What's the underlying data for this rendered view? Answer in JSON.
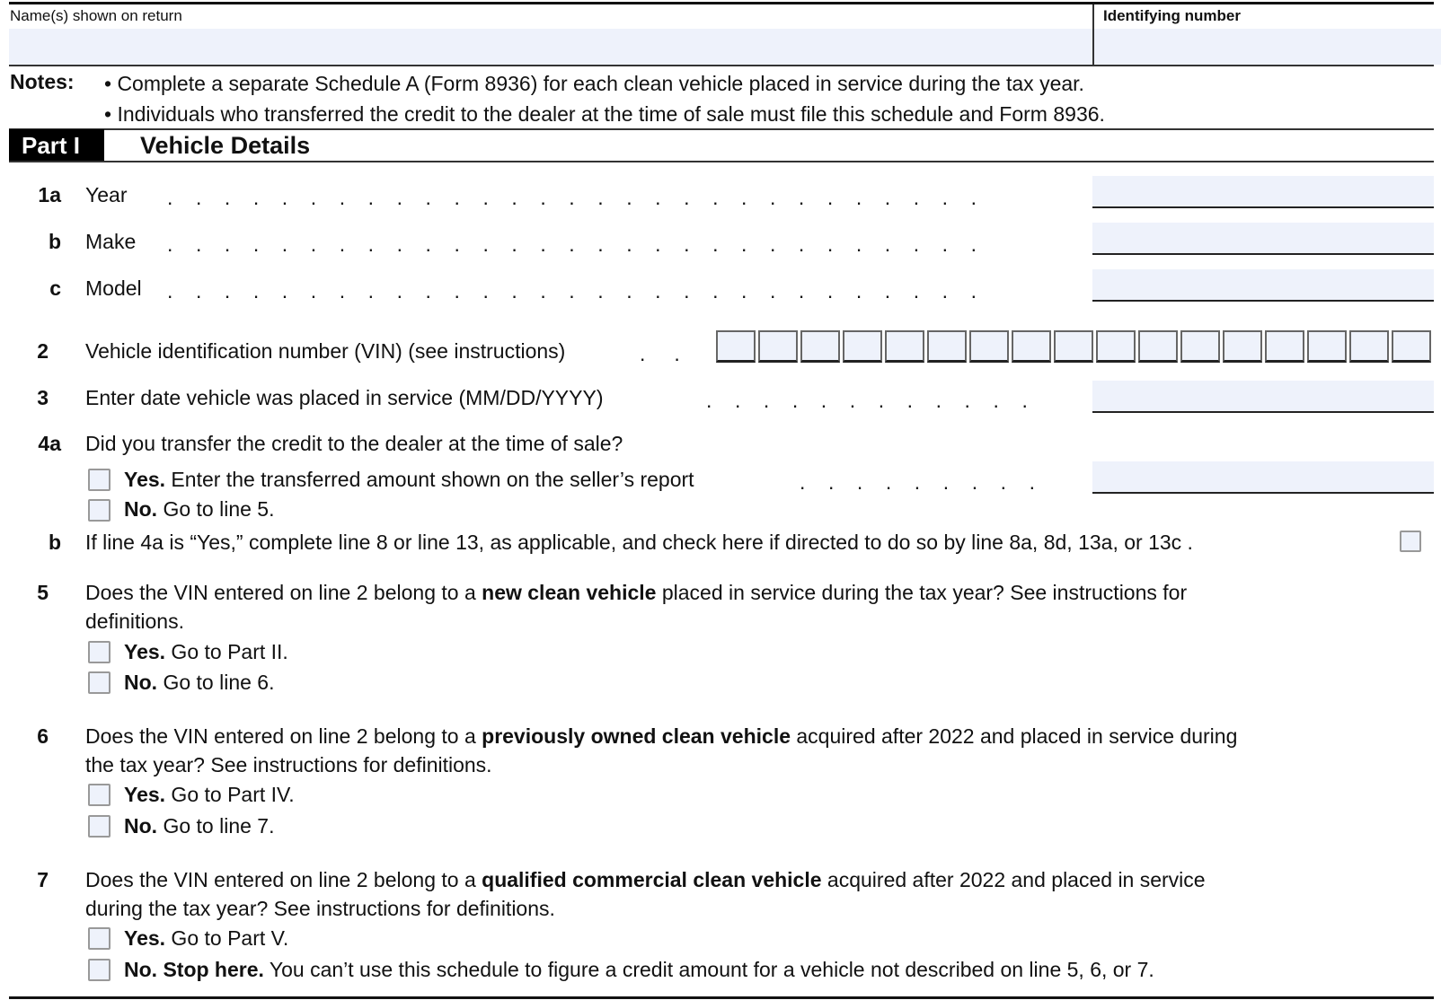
{
  "header": {
    "name_label": "Name(s) shown on return",
    "name_value": "",
    "id_label": "Identifying number",
    "id_value": ""
  },
  "notes": {
    "label": "Notes:",
    "items": [
      "• Complete a separate Schedule A (Form 8936) for each clean vehicle placed in service during the tax year.",
      "• Individuals who transferred the credit to the dealer at the time of sale must file this schedule and Form 8936."
    ]
  },
  "part": {
    "badge": "Part I",
    "title": "Vehicle Details"
  },
  "lines": {
    "l1a": {
      "num": "1a",
      "label": "Year",
      "value": ""
    },
    "l1b": {
      "num": "b",
      "label": "Make",
      "value": ""
    },
    "l1c": {
      "num": "c",
      "label": "Model",
      "value": ""
    },
    "l2": {
      "num": "2",
      "label": "Vehicle identification number (VIN) (see instructions)",
      "vin_boxes": 17,
      "value": ""
    },
    "l3": {
      "num": "3",
      "label": "Enter date vehicle was placed in service (MM/DD/YYYY)",
      "value": ""
    },
    "l4a": {
      "num": "4a",
      "question": "Did you transfer the credit to the dealer at the time of sale?",
      "yes_bold": "Yes.",
      "yes_text": " Enter the transferred amount shown on the seller’s report",
      "no_bold": "No.",
      "no_text": " Go to line 5.",
      "yes_checked": false,
      "no_checked": false,
      "amount": ""
    },
    "l4b": {
      "num": "b",
      "text": "If line 4a is “Yes,” complete line 8 or line 13, as applicable, and check here if directed to do so by line 8a, 8d, 13a, or 13c",
      "checked": false
    },
    "l5": {
      "num": "5",
      "pre": "Does the VIN entered on line 2 belong to a ",
      "bold": "new clean vehicle",
      "post": " placed in service during the tax year? See instructions for",
      "line2": "definitions.",
      "yes_bold": "Yes.",
      "yes_text": " Go to Part II.",
      "no_bold": "No.",
      "no_text": " Go to line 6."
    },
    "l6": {
      "num": "6",
      "pre": "Does the VIN entered on line 2 belong to a ",
      "bold": "previously owned clean vehicle",
      "post": " acquired after 2022 and placed in service during",
      "line2": "the tax year? See instructions for definitions.",
      "yes_bold": "Yes.",
      "yes_text": " Go to Part IV.",
      "no_bold": "No.",
      "no_text": " Go to line 7."
    },
    "l7": {
      "num": "7",
      "pre": "Does the VIN entered on line 2 belong to a ",
      "bold": "qualified commercial clean vehicle",
      "post": " acquired after 2022 and placed in service",
      "line2": "during the tax year? See instructions for definitions.",
      "yes_bold": "Yes.",
      "yes_text": " Go to Part V.",
      "no_bold": "No. Stop here.",
      "no_text": " You can’t use this schedule to figure a credit amount for a vehicle not described on line 5, 6, or 7."
    }
  },
  "colors": {
    "field_fill": "#eef2fb",
    "part_badge_bg": "#000000"
  }
}
